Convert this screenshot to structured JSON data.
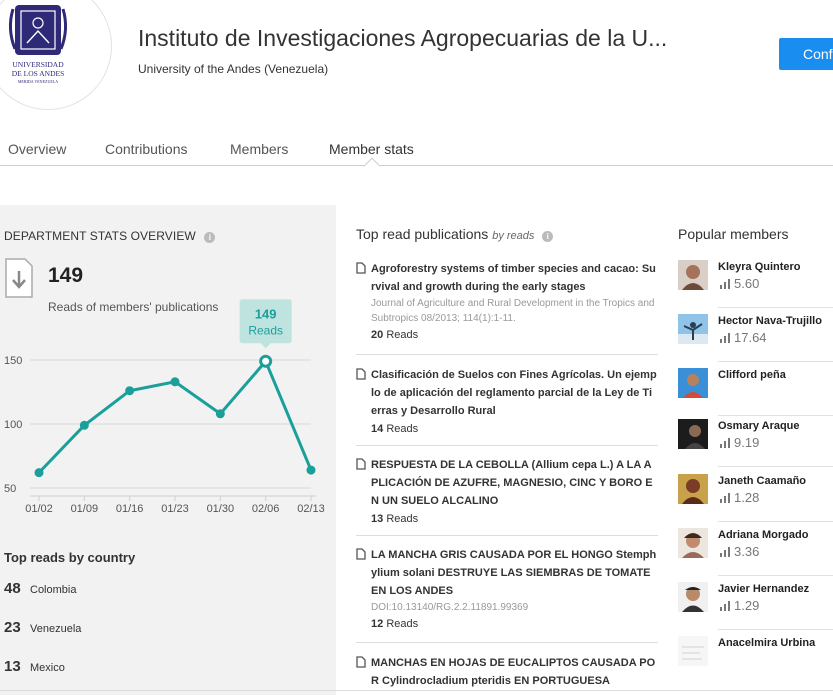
{
  "institution": {
    "logo_text_1": "UNIVERSIDAD",
    "logo_text_2": "DE LOS ANDES",
    "logo_text_3": "MERIDA VENEZUELA",
    "name": "Instituto de Investigaciones Agropecuarias de la U...",
    "affiliation": "University of the Andes (Venezuela)",
    "follow_label": "Conf"
  },
  "tabs": [
    {
      "label": "Overview"
    },
    {
      "label": "Contributions"
    },
    {
      "label": "Members"
    },
    {
      "label": "Member stats"
    }
  ],
  "stats": {
    "title": "DEPARTMENT STATS OVERVIEW",
    "info_glyph": "i",
    "total_reads": "149",
    "reads_label": "Reads of members' publications",
    "tooltip_value": "149",
    "tooltip_label": "Reads"
  },
  "chart_data": {
    "type": "line",
    "categories": [
      "01/02",
      "01/09",
      "01/16",
      "01/23",
      "01/30",
      "02/06",
      "02/13"
    ],
    "values": [
      62,
      99,
      126,
      133,
      108,
      149,
      64
    ],
    "y_ticks": [
      50,
      100,
      150
    ],
    "ylim": [
      50,
      150
    ],
    "highlight_index": 5,
    "color": "#1a9f9a",
    "grid": true
  },
  "countries": {
    "title": "Top reads by country",
    "rows": [
      {
        "count": "48",
        "name": "Colombia"
      },
      {
        "count": "23",
        "name": "Venezuela"
      },
      {
        "count": "13",
        "name": "Mexico"
      }
    ]
  },
  "publications": {
    "heading": "Top read publications",
    "heading_suffix": "by reads",
    "reads_word": "Reads",
    "items": [
      {
        "title": "Agroforestry systems of timber species and cacao: Survival and growth during the early stages",
        "meta": "Journal of Agriculture and Rural Development in the Tropics and Subtropics 08/2013; 114(1):1-11.",
        "reads": "20"
      },
      {
        "title": "Clasificación de Suelos con Fines Agrícolas. Un ejemplo de aplicación del reglamento parcial de la Ley de Tierras y Desarrollo Rural",
        "meta": "",
        "reads": "14"
      },
      {
        "title": "RESPUESTA DE LA CEBOLLA (Allium cepa L.) A LA APLICACIÓN DE AZUFRE, MAGNESIO, CINC Y BORO EN UN SUELO ALCALINO",
        "meta": "",
        "reads": "13"
      },
      {
        "title": "LA MANCHA GRIS CAUSADA POR EL HONGO Stemphylium solani DESTRUYE LAS SIEMBRAS DE TOMATE EN LOS ANDES",
        "meta": "DOI:10.13140/RG.2.2.11891.99369",
        "reads": "12"
      },
      {
        "title": "MANCHAS EN HOJAS DE EUCALIPTOS CAUSADA POR Cylindrocladium pteridis EN PORTUGUESA",
        "meta": "",
        "reads": ""
      }
    ]
  },
  "members": {
    "heading": "Popular members",
    "items": [
      {
        "name": "Kleyra Quintero",
        "score": "5.60"
      },
      {
        "name": "Hector Nava-Trujillo",
        "score": "17.64"
      },
      {
        "name": "Clifford peña",
        "score": ""
      },
      {
        "name": "Osmary Araque",
        "score": "9.19"
      },
      {
        "name": "Janeth Caamaño",
        "score": "1.28"
      },
      {
        "name": "Adriana Morgado",
        "score": "3.36"
      },
      {
        "name": "Javier Hernandez",
        "score": "1.29"
      },
      {
        "name": "Anacelmira Urbina",
        "score": ""
      }
    ]
  }
}
